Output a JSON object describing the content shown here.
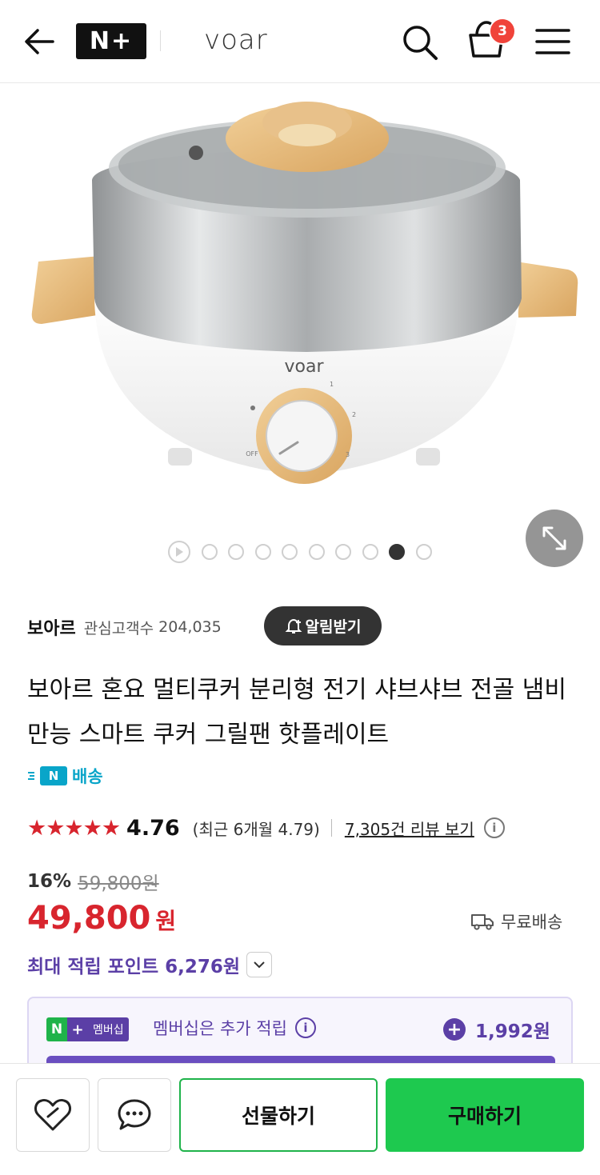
{
  "header": {
    "logo_text": "N+",
    "brand": "voar",
    "cart_count": "3"
  },
  "gallery": {
    "image_brand_mark": "voar",
    "dial_labels": [
      "OFF",
      "1",
      "2",
      "3"
    ],
    "page_total": 10,
    "page_active_index": 8
  },
  "store": {
    "name": "보아르",
    "follower_label": "관심고객수",
    "follower_count": "204,035",
    "alarm_label": "알림받기"
  },
  "product": {
    "title": "보아르 혼요 멀티쿠커 분리형 전기 샤브샤브 전골 냄비 만능 스마트 쿠커 그릴팬 핫플레이트",
    "delivery_tag": "배송",
    "delivery_badge": "N"
  },
  "rating": {
    "stars": "★★★★★",
    "score": "4.76",
    "recent": "(최근 6개월 4.79)",
    "review_link": "7,305건 리뷰 보기",
    "info": "i"
  },
  "price": {
    "discount_rate": "16%",
    "original": "59,800원",
    "sale": "49,800",
    "unit": "원",
    "free_shipping": "무료배송"
  },
  "points": {
    "label": "최대 적립 포인트 6,276원"
  },
  "membership": {
    "badge_n": "N",
    "badge_plus": "+",
    "badge_label": "멤버십",
    "text": "멤버십은 추가 적립",
    "info": "i",
    "plus": "+",
    "points": "1,992원"
  },
  "bottom_bar": {
    "gift_label": "선물하기",
    "buy_label": "구매하기"
  },
  "colors": {
    "price_red": "#d8252e",
    "naver_green": "#1ec94f",
    "purple": "#5b3fa6",
    "delivery_blue": "#09a5c9"
  }
}
